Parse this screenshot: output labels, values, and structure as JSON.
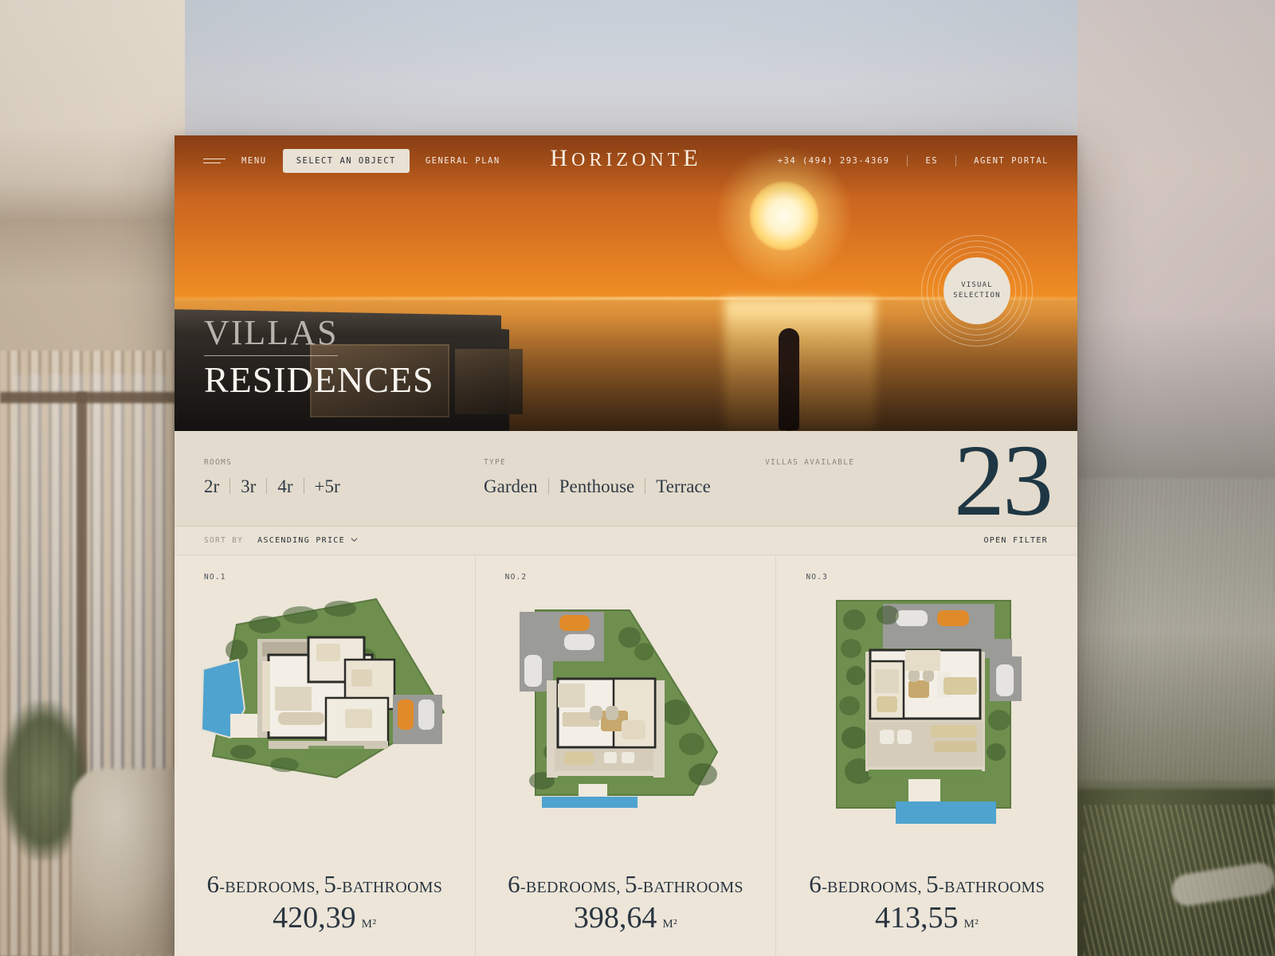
{
  "nav": {
    "menu_label": "MENU",
    "select_object_label": "SELECT AN OBJECT",
    "general_plan_label": "GENERAL PLAN",
    "logo": "HORIZONTE",
    "phone": "+34 (494) 293-4369",
    "language": "ES",
    "agent_portal_label": "AGENT PORTAL"
  },
  "hero": {
    "title_line1": "VILLAS",
    "title_line2": "RESIDENCES",
    "visual_selection_line1": "VISUAL",
    "visual_selection_line2": "SELECTION"
  },
  "filters": {
    "rooms_caption": "ROOMS",
    "rooms_options": [
      "2r",
      "3r",
      "4r",
      "+5r"
    ],
    "type_caption": "TYPE",
    "type_options": [
      "Garden",
      "Penthouse",
      "Terrace"
    ],
    "available_caption": "VILLAS AVAILABLE",
    "available_count": "23"
  },
  "sort": {
    "caption": "SORT BY",
    "value": "ASCENDING PRICE",
    "open_filter_label": "OPEN FILTER"
  },
  "cards": [
    {
      "number": "NO.1",
      "bedrooms": "6",
      "bedrooms_label": "-BEDROOMS,",
      "bathrooms": "5",
      "bathrooms_label": "-BATHROOMS",
      "area": "420,39",
      "area_unit": "M²"
    },
    {
      "number": "NO.2",
      "bedrooms": "6",
      "bedrooms_label": "-BEDROOMS,",
      "bathrooms": "5",
      "bathrooms_label": "-BATHROOMS",
      "area": "398,64",
      "area_unit": "M²"
    },
    {
      "number": "NO.3",
      "bedrooms": "6",
      "bedrooms_label": "-BEDROOMS,",
      "bathrooms": "5",
      "bathrooms_label": "-BATHROOMS",
      "area": "413,55",
      "area_unit": "M²"
    }
  ],
  "colors": {
    "accent_navy": "#1f3744",
    "panel_beige": "#e3dbcd",
    "card_beige": "#ece5d8",
    "hero_orange": "#e07b22",
    "pill_bg": "#e8e1d4"
  }
}
